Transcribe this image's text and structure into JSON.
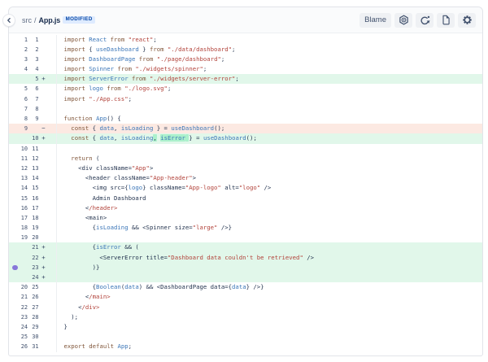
{
  "header": {
    "breadcrumb": {
      "dir": "src",
      "separator": "/",
      "file": "App.js"
    },
    "status_badge": "MODIFIED",
    "blame_button": "Blame",
    "icon_buttons": [
      "nut-icon",
      "refresh-icon",
      "file-icon",
      "gear-icon"
    ]
  },
  "colors": {
    "badge_bg": "#DEEBFF",
    "badge_text": "#0747A6",
    "added_row_bg": "#E1F7EA",
    "removed_row_bg": "#FCE9E2",
    "word_highlight_bg": "#ABF0CC",
    "comment_dot": "#8777D9",
    "keyword": "#80563A",
    "identifier": "#3B76B8",
    "string": "#B2423A",
    "plain_code": "#24344F",
    "icon_color": "#42526E"
  },
  "diff": {
    "marker_add": "+",
    "marker_del": "−",
    "rows": [
      {
        "old": "1",
        "new": "1",
        "type": "context",
        "tokens": [
          [
            "k",
            "import"
          ],
          [
            "p",
            " "
          ],
          [
            "v",
            "React"
          ],
          [
            "p",
            " "
          ],
          [
            "k",
            "from"
          ],
          [
            "p",
            " "
          ],
          [
            "s",
            "\"react\""
          ],
          [
            "p",
            ";"
          ]
        ]
      },
      {
        "old": "2",
        "new": "2",
        "type": "context",
        "tokens": [
          [
            "k",
            "import"
          ],
          [
            "p",
            " { "
          ],
          [
            "v",
            "useDashboard"
          ],
          [
            "p",
            " } "
          ],
          [
            "k",
            "from"
          ],
          [
            "p",
            " "
          ],
          [
            "s",
            "\"./data/dashboard\""
          ],
          [
            "p",
            ";"
          ]
        ]
      },
      {
        "old": "3",
        "new": "3",
        "type": "context",
        "tokens": [
          [
            "k",
            "import"
          ],
          [
            "p",
            " "
          ],
          [
            "v",
            "DashboardPage"
          ],
          [
            "p",
            " "
          ],
          [
            "k",
            "from"
          ],
          [
            "p",
            " "
          ],
          [
            "s",
            "\"./page/dashboard\""
          ],
          [
            "p",
            ";"
          ]
        ]
      },
      {
        "old": "4",
        "new": "4",
        "type": "context",
        "tokens": [
          [
            "k",
            "import"
          ],
          [
            "p",
            " "
          ],
          [
            "v",
            "Spinner"
          ],
          [
            "p",
            " "
          ],
          [
            "k",
            "from"
          ],
          [
            "p",
            " "
          ],
          [
            "s",
            "\"./widgets/spinner\""
          ],
          [
            "p",
            ";"
          ]
        ]
      },
      {
        "old": "",
        "new": "5",
        "type": "add",
        "tokens": [
          [
            "k",
            "import"
          ],
          [
            "p",
            " "
          ],
          [
            "v",
            "ServerError"
          ],
          [
            "p",
            " "
          ],
          [
            "k",
            "from"
          ],
          [
            "p",
            " "
          ],
          [
            "s",
            "\"./widgets/server-error\""
          ],
          [
            "p",
            ";"
          ]
        ]
      },
      {
        "old": "5",
        "new": "6",
        "type": "context",
        "tokens": [
          [
            "k",
            "import"
          ],
          [
            "p",
            " "
          ],
          [
            "v",
            "logo"
          ],
          [
            "p",
            " "
          ],
          [
            "k",
            "from"
          ],
          [
            "p",
            " "
          ],
          [
            "s",
            "\"./logo.svg\""
          ],
          [
            "p",
            ";"
          ]
        ]
      },
      {
        "old": "6",
        "new": "7",
        "type": "context",
        "tokens": [
          [
            "k",
            "import"
          ],
          [
            "p",
            " "
          ],
          [
            "s",
            "\"./App.css\""
          ],
          [
            "p",
            ";"
          ]
        ]
      },
      {
        "old": "7",
        "new": "8",
        "type": "context",
        "tokens": []
      },
      {
        "old": "8",
        "new": "9",
        "type": "context",
        "tokens": [
          [
            "k",
            "function"
          ],
          [
            "p",
            " "
          ],
          [
            "v",
            "App"
          ],
          [
            "p",
            "() {"
          ]
        ]
      },
      {
        "old": "9",
        "new": "",
        "type": "del",
        "tokens": [
          [
            "p",
            "  "
          ],
          [
            "k",
            "const"
          ],
          [
            "p",
            " { "
          ],
          [
            "v",
            "data"
          ],
          [
            "p",
            ", "
          ],
          [
            "v",
            "isLoading"
          ],
          [
            "p",
            " } = "
          ],
          [
            "v",
            "useDashboard"
          ],
          [
            "p",
            "();"
          ]
        ]
      },
      {
        "old": "",
        "new": "10",
        "type": "add",
        "tokens": [
          [
            "p",
            "  "
          ],
          [
            "k",
            "const"
          ],
          [
            "p",
            " { "
          ],
          [
            "v",
            "data"
          ],
          [
            "p",
            ", "
          ],
          [
            "v",
            "isLoading"
          ],
          [
            "p hl",
            ","
          ],
          [
            "p",
            " "
          ],
          [
            "v hl",
            "isError"
          ],
          [
            "p hl",
            " "
          ],
          [
            "p",
            "} = "
          ],
          [
            "v",
            "useDashboard"
          ],
          [
            "p",
            "();"
          ]
        ]
      },
      {
        "old": "10",
        "new": "11",
        "type": "context",
        "tokens": []
      },
      {
        "old": "11",
        "new": "12",
        "type": "context",
        "tokens": [
          [
            "p",
            "  "
          ],
          [
            "k",
            "return"
          ],
          [
            "p",
            " ("
          ]
        ]
      },
      {
        "old": "12",
        "new": "13",
        "type": "context",
        "tokens": [
          [
            "p",
            "    <div className="
          ],
          [
            "s",
            "\"App\""
          ],
          [
            "p",
            ">"
          ]
        ]
      },
      {
        "old": "13",
        "new": "14",
        "type": "context",
        "tokens": [
          [
            "p",
            "      <header className="
          ],
          [
            "s",
            "\"App-header\""
          ],
          [
            "p",
            ">"
          ]
        ]
      },
      {
        "old": "14",
        "new": "15",
        "type": "context",
        "tokens": [
          [
            "p",
            "        <img src={"
          ],
          [
            "v",
            "logo"
          ],
          [
            "p",
            "} className="
          ],
          [
            "s",
            "\"App-logo\""
          ],
          [
            "p",
            " alt="
          ],
          [
            "s",
            "\"logo\""
          ],
          [
            "p",
            " />"
          ]
        ]
      },
      {
        "old": "15",
        "new": "16",
        "type": "context",
        "tokens": [
          [
            "p",
            "        Admin Dashboard"
          ]
        ]
      },
      {
        "old": "16",
        "new": "17",
        "type": "context",
        "tokens": [
          [
            "p",
            "      <"
          ],
          [
            "s",
            "/header>"
          ]
        ]
      },
      {
        "old": "17",
        "new": "18",
        "type": "context",
        "tokens": [
          [
            "p",
            "      <main>"
          ]
        ]
      },
      {
        "old": "18",
        "new": "19",
        "type": "context",
        "tokens": [
          [
            "p",
            "        {"
          ],
          [
            "v",
            "isLoading"
          ],
          [
            "p",
            " && <Spinner size="
          ],
          [
            "s",
            "\"large\""
          ],
          [
            "p",
            " />}"
          ]
        ]
      },
      {
        "old": "19",
        "new": "20",
        "type": "context",
        "tokens": []
      },
      {
        "old": "",
        "new": "21",
        "type": "add",
        "tokens": [
          [
            "p",
            "        {"
          ],
          [
            "v",
            "isError"
          ],
          [
            "p",
            " && ("
          ]
        ]
      },
      {
        "old": "",
        "new": "22",
        "type": "add",
        "tokens": [
          [
            "p",
            "          <ServerError title="
          ],
          [
            "s",
            "\"Dashboard data couldn't be retrieved\""
          ],
          [
            "p",
            " />"
          ]
        ]
      },
      {
        "old": "",
        "new": "23",
        "type": "add",
        "dot": true,
        "tokens": [
          [
            "p",
            "        )}"
          ]
        ]
      },
      {
        "old": "",
        "new": "24",
        "type": "add",
        "tokens": []
      },
      {
        "old": "20",
        "new": "25",
        "type": "context",
        "tokens": [
          [
            "p",
            "        {"
          ],
          [
            "v",
            "Boolean"
          ],
          [
            "p",
            "("
          ],
          [
            "v",
            "data"
          ],
          [
            "p",
            ") && <DashboardPage data={"
          ],
          [
            "v",
            "data"
          ],
          [
            "p",
            "} />}"
          ]
        ]
      },
      {
        "old": "21",
        "new": "26",
        "type": "context",
        "tokens": [
          [
            "p",
            "      <"
          ],
          [
            "s",
            "/main>"
          ]
        ]
      },
      {
        "old": "22",
        "new": "27",
        "type": "context",
        "tokens": [
          [
            "p",
            "    <"
          ],
          [
            "s",
            "/div>"
          ]
        ]
      },
      {
        "old": "23",
        "new": "28",
        "type": "context",
        "tokens": [
          [
            "p",
            "  );"
          ]
        ]
      },
      {
        "old": "24",
        "new": "29",
        "type": "context",
        "tokens": [
          [
            "p",
            "}"
          ]
        ]
      },
      {
        "old": "25",
        "new": "30",
        "type": "context",
        "tokens": []
      },
      {
        "old": "26",
        "new": "31",
        "type": "context",
        "tokens": [
          [
            "k",
            "export"
          ],
          [
            "p",
            " "
          ],
          [
            "k",
            "default"
          ],
          [
            "p",
            " "
          ],
          [
            "v",
            "App"
          ],
          [
            "p",
            ";"
          ]
        ]
      }
    ]
  }
}
